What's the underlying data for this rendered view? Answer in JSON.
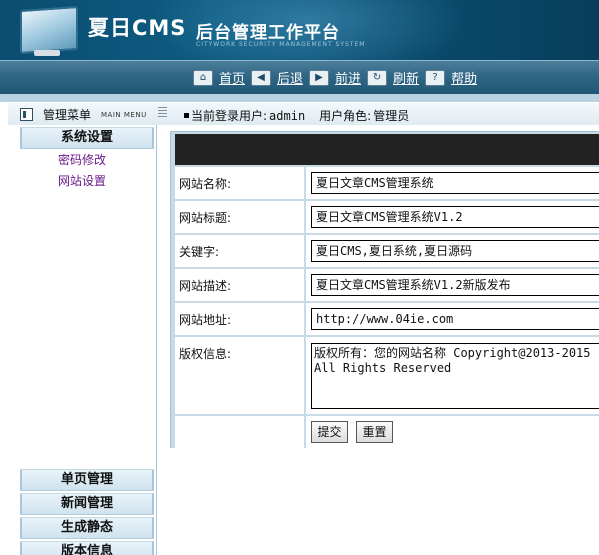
{
  "header": {
    "logo_main": "夏日CMS",
    "logo_sub": "后台管理工作平台",
    "logo_en": "CITYWORK SECURITY MANAGEMENT SYSTEM"
  },
  "toolbar": {
    "items": [
      {
        "label": "首页",
        "icon": "home-icon"
      },
      {
        "label": "后退",
        "icon": "back-arrow-icon"
      },
      {
        "label": "前进",
        "icon": "forward-arrow-icon"
      },
      {
        "label": "刷新",
        "icon": "refresh-icon"
      },
      {
        "label": "帮助",
        "icon": "help-icon"
      }
    ]
  },
  "subheader": {
    "menu_title": "管理菜单",
    "menu_title_en": "MAIN MENU",
    "user_label": "当前登录用户:",
    "user_name": "admin",
    "role_label": "用户角色:",
    "role_name": "管理员"
  },
  "sidebar": {
    "groups": [
      {
        "title": "系统设置",
        "items": [
          "密码修改",
          "网站设置"
        ]
      },
      {
        "title": "单页管理",
        "items": []
      },
      {
        "title": "新闻管理",
        "items": []
      },
      {
        "title": "生成静态",
        "items": []
      },
      {
        "title": "版本信息",
        "items": []
      }
    ]
  },
  "form": {
    "fields": [
      {
        "label": "网站名称:",
        "value": "夏日文章CMS管理系统"
      },
      {
        "label": "网站标题:",
        "value": "夏日文章CMS管理系统V1.2"
      },
      {
        "label": "关键字:",
        "value": "夏日CMS,夏日系统,夏日源码"
      },
      {
        "label": "网站描述:",
        "value": "夏日文章CMS管理系统V1.2新版发布"
      },
      {
        "label": "网站地址:",
        "value": "http://www.04ie.com"
      },
      {
        "label": "版权信息:",
        "value": "版权所有：您的网站名称 Copyright@2013-2015 All Rights Reserved"
      }
    ],
    "submit_label": "提交",
    "reset_label": "重置"
  },
  "colors": {
    "header_bg": "#0e5b82",
    "toolbar_bg": "#2f6585",
    "panel_border": "#c7dbe7",
    "form_head": "#222222",
    "link_purple": "#6a1b8a"
  }
}
